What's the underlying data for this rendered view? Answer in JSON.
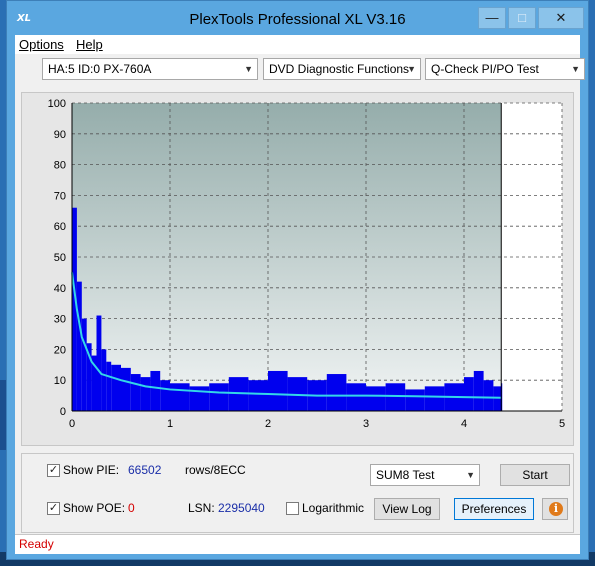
{
  "window": {
    "title": "PlexTools Professional XL V3.16",
    "icon_label": "XL",
    "minimize_icon": "minimize-icon",
    "maximize_icon": "maximize-icon",
    "close_icon": "close-icon"
  },
  "menu": {
    "options": "Options",
    "help": "Help"
  },
  "toolbar": {
    "drive": "HA:5 ID:0  PX-760A",
    "function": "DVD Diagnostic Functions",
    "test": "Q-Check PI/PO Test"
  },
  "chart_data": {
    "type": "bar",
    "title": "",
    "xlabel": "",
    "ylabel": "",
    "xlim": [
      0,
      5
    ],
    "ylim": [
      0,
      100
    ],
    "xticks": [
      "0",
      "1",
      "2",
      "3",
      "4",
      "5"
    ],
    "yticks": [
      "0",
      "10",
      "20",
      "30",
      "40",
      "50",
      "60",
      "70",
      "80",
      "90",
      "100"
    ],
    "grid": true,
    "end_marker_x": 4.38,
    "colors": {
      "bars": "#0000ee",
      "trend": "#33d6e8",
      "bg_top": "#95adab",
      "bg_bottom": "#f2f5f5"
    },
    "series": [
      {
        "type": "bar",
        "x": [
          0.0,
          0.05,
          0.1,
          0.15,
          0.2,
          0.25,
          0.3,
          0.35,
          0.4,
          0.5,
          0.6,
          0.7,
          0.8,
          0.9,
          1.0,
          1.2,
          1.4,
          1.6,
          1.8,
          2.0,
          2.2,
          2.4,
          2.6,
          2.8,
          3.0,
          3.2,
          3.4,
          3.6,
          3.8,
          4.0,
          4.1,
          4.2,
          4.3,
          4.38
        ],
        "values": [
          66,
          42,
          30,
          22,
          18,
          31,
          20,
          16,
          15,
          14,
          12,
          11,
          13,
          10,
          9,
          8,
          9,
          11,
          10,
          13,
          11,
          10,
          12,
          9,
          8,
          9,
          7,
          8,
          9,
          11,
          13,
          10,
          8,
          9
        ]
      },
      {
        "type": "line",
        "x": [
          0.0,
          0.05,
          0.1,
          0.2,
          0.3,
          0.5,
          0.75,
          1.0,
          1.5,
          2.0,
          2.5,
          3.0,
          3.5,
          4.0,
          4.38
        ],
        "values": [
          45,
          33,
          24,
          16,
          12,
          10,
          8,
          7,
          6,
          5.5,
          5,
          5,
          4.8,
          4.5,
          4.3
        ]
      }
    ]
  },
  "stats": {
    "show_pie_label": "Show PIE:",
    "pie_value": "66502",
    "pie_unit": "rows/8ECC",
    "show_poe_label": "Show POE:",
    "poe_value": "0",
    "lsn_label": "LSN:",
    "lsn_value": "2295040",
    "log_label": "Logarithmic",
    "mode_select": "SUM8 Test"
  },
  "buttons": {
    "start": "Start",
    "view_log": "View Log",
    "preferences": "Preferences"
  },
  "status": {
    "text": "Ready"
  }
}
